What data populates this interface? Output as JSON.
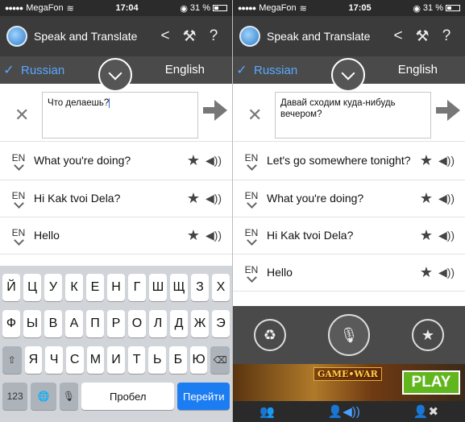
{
  "screens": [
    {
      "status": {
        "carrier": "MegaFon",
        "time": "17:04",
        "battery": "31 %"
      },
      "title": "Speak and Translate",
      "icons": {
        "share": "share-icon",
        "settings": "wrench-icon",
        "help": "help-icon"
      },
      "source_lang": "Russian",
      "target_lang": "English",
      "input_text": "Что делаешь?",
      "results": [
        {
          "lang": "EN",
          "text": "What you're doing?"
        },
        {
          "lang": "EN",
          "text": "Hi Kak tvoi Dela?"
        },
        {
          "lang": "EN",
          "text": "Hello"
        }
      ],
      "keyboard": {
        "row1": [
          "Й",
          "Ц",
          "У",
          "К",
          "Е",
          "Н",
          "Г",
          "Ш",
          "Щ",
          "З",
          "Х"
        ],
        "row2": [
          "Ф",
          "Ы",
          "В",
          "А",
          "П",
          "Р",
          "О",
          "Л",
          "Д",
          "Ж",
          "Э"
        ],
        "row3": [
          "Я",
          "Ч",
          "С",
          "М",
          "И",
          "Т",
          "Ь",
          "Б",
          "Ю"
        ],
        "num": "123",
        "space": "Пробел",
        "go": "Перейти"
      }
    },
    {
      "status": {
        "carrier": "MegaFon",
        "time": "17:05",
        "battery": "31 %"
      },
      "title": "Speak and Translate",
      "source_lang": "Russian",
      "target_lang": "English",
      "input_text": "Давай сходим куда-нибудь вечером?",
      "results": [
        {
          "lang": "EN",
          "text": "Let's go somewhere tonight?"
        },
        {
          "lang": "EN",
          "text": "What you're doing?"
        },
        {
          "lang": "EN",
          "text": "Hi Kak tvoi Dela?"
        },
        {
          "lang": "EN",
          "text": "Hello"
        }
      ],
      "ad": {
        "title": "GAME•WAR",
        "cta": "PLAY"
      }
    }
  ],
  "colors": {
    "accent": "#5aa8ff",
    "bar": "#3b3b3b",
    "go_key": "#1c7cf2",
    "ad_play": "#61b61d"
  }
}
